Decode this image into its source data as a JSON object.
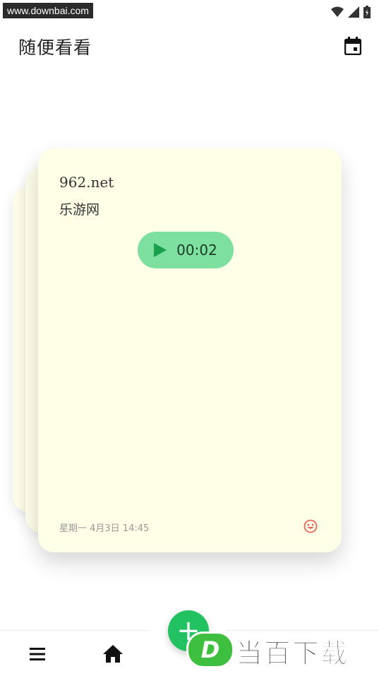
{
  "status_bar": {
    "watermark": "www.downbai.com"
  },
  "header": {
    "title": "随便看看"
  },
  "card": {
    "heading": "962.net",
    "subtitle": "乐游网",
    "audio_duration": "00:02",
    "date": "星期一 4月3日 14:45"
  },
  "colors": {
    "card_bg": "#fffee7",
    "accent_green": "#22c262",
    "audio_pill": "#7ee0a0",
    "mood_icon": "#e8574a"
  },
  "bottom_nav": {
    "menu_icon": "menu-icon",
    "home_icon": "home-icon",
    "fab_icon": "plus-icon"
  },
  "watermark_logo": {
    "letter": "D",
    "text": "当百下载"
  }
}
